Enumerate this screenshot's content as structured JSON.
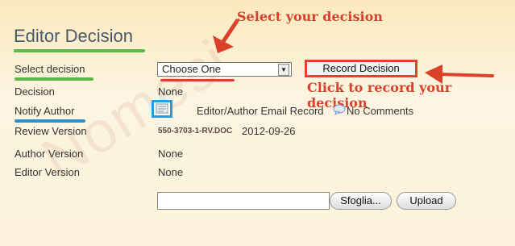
{
  "watermark": "Nomesi",
  "page_title": "Editor Decision",
  "labels": {
    "select_decision": "Select decision",
    "decision": "Decision",
    "notify_author": "Notify Author",
    "review_version": "Review Version",
    "author_version": "Author Version",
    "editor_version": "Editor Version"
  },
  "decision_select": {
    "selected": "Choose One"
  },
  "record_button": "Record Decision",
  "decision_value": "None",
  "notify": {
    "email_record": "Editor/Author Email Record",
    "comments": "No Comments"
  },
  "review": {
    "file": "550-3703-1-RV.DOC",
    "date": "2012-09-26"
  },
  "author_version_value": "None",
  "editor_version_value": "None",
  "upload": {
    "browse_label": "Sfoglia...",
    "upload_label": "Upload"
  },
  "annotations": {
    "select_hint": "Select your decision",
    "record_hint": "Click to record your decision"
  },
  "colors": {
    "annotation": "#d9412b",
    "title_underline": "#5bb847",
    "notify_underline": "#2a8fd0",
    "record_border": "#e0442a"
  }
}
